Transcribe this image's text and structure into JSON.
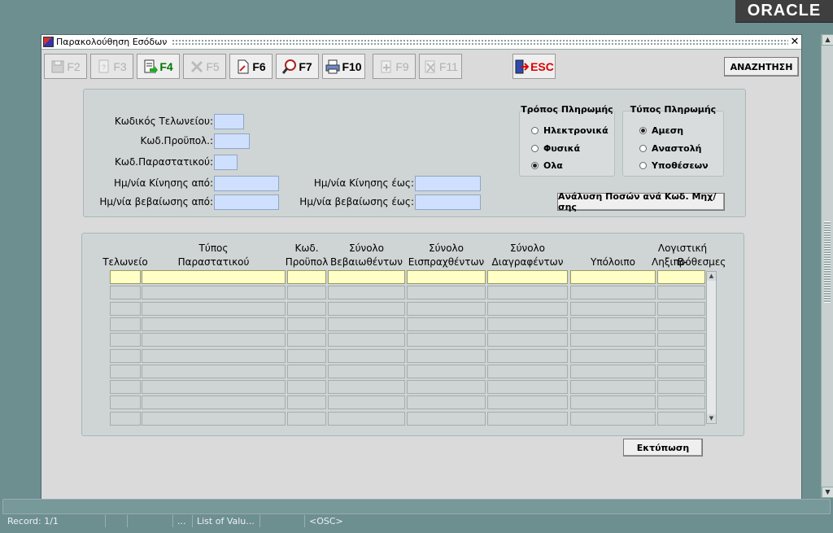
{
  "brand": {
    "logo_text": "ORACLE"
  },
  "window": {
    "title": "Παρακολούθηση Εσόδων"
  },
  "toolbar": {
    "buttons": [
      {
        "label": "F2",
        "enabled": false,
        "icon": "save-icon"
      },
      {
        "label": "F3",
        "enabled": false,
        "icon": "query-icon"
      },
      {
        "label": "F4",
        "enabled": true,
        "icon": "execute-icon"
      },
      {
        "label": "F5",
        "enabled": false,
        "icon": "clear-icon"
      },
      {
        "label": "F6",
        "enabled": true,
        "icon": "document-icon"
      },
      {
        "label": "F7",
        "enabled": true,
        "icon": "magnifier-icon"
      },
      {
        "label": "F10",
        "enabled": true,
        "icon": "printer-icon"
      },
      {
        "label": "F9",
        "enabled": false,
        "icon": "add-record-icon"
      },
      {
        "label": "F11",
        "enabled": false,
        "icon": "delete-record-icon"
      },
      {
        "label": "ESC",
        "enabled": true,
        "icon": "exit-icon"
      }
    ],
    "search_label": "ΑΝΑΖΗΤΗΣΗ"
  },
  "criteria": {
    "customs_code_label": "Κωδικός Τελωνείου:",
    "budget_code_label": "Κωδ.Προϋπολ.:",
    "document_code_label": "Κωδ.Παραστατικού:",
    "move_from_label": "Ημ/νία Κίνησης από:",
    "certify_from_label": "Ημ/νία βεβαίωσης από:",
    "move_to_label": "Ημ/νία Κίνησης έως:",
    "certify_to_label": "Ημ/νία βεβαίωσης έως:",
    "values": {
      "customs_code": "",
      "budget_code": "",
      "document_code": "",
      "move_from": "",
      "certify_from": "",
      "move_to": "",
      "certify_to": ""
    }
  },
  "payment_method": {
    "title": "Τρόπος Πληρωμής",
    "options": [
      "Ηλεκτρονικά",
      "Φυσικά",
      "Ολα"
    ],
    "selected": "Ολα"
  },
  "payment_type": {
    "title": "Τύπος Πληρωμής",
    "options": [
      "Αμεση",
      "Αναστολή",
      "Υποθέσεων"
    ],
    "selected": "Αμεση"
  },
  "analysis_button_label": "Ανάλυση Ποσών ανά Κωδ. Μηχ/σης",
  "grid": {
    "columns": [
      {
        "line1": "",
        "line2": "Τελωνείο"
      },
      {
        "line1": "Τύπος",
        "line2": "Παραστατικού"
      },
      {
        "line1": "Κωδ.",
        "line2": "Προϋπολ"
      },
      {
        "line1": "Σύνολο",
        "line2": "Βεβαιωθέντων"
      },
      {
        "line1": "Σύνολο",
        "line2": "Εισπραχθέντων"
      },
      {
        "line1": "Σύνολο",
        "line2": "Διαγραφέντων"
      },
      {
        "line1": "",
        "line2": "Υπόλοιπο"
      },
      {
        "line1": "Λογιστική Β-",
        "line2": "Ληξιπρόθεσμες"
      }
    ],
    "row_count": 10
  },
  "print_button_label": "Εκτύπωση",
  "statusbar": {
    "record": "Record: 1/1",
    "seg2": "",
    "seg3": "",
    "seg4": "...",
    "seg5": "List of Valu...",
    "seg6": "",
    "seg7": "<OSC>"
  }
}
